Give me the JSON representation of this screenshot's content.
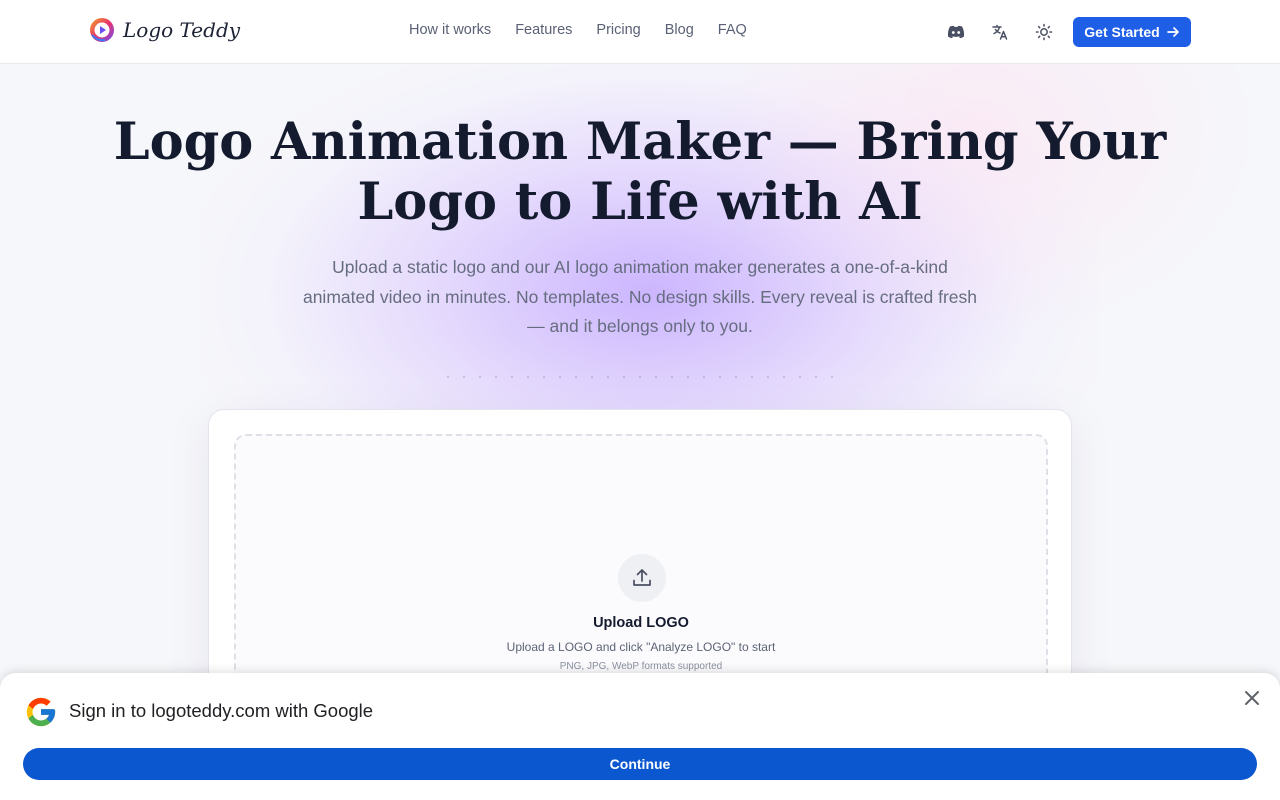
{
  "header": {
    "brand_name": "Logo Teddy",
    "nav": [
      "How it works",
      "Features",
      "Pricing",
      "Blog",
      "FAQ"
    ],
    "icons": [
      "discord-icon",
      "translate-icon",
      "sun-icon"
    ],
    "cta_label": "Get Started"
  },
  "hero": {
    "title": "Logo Animation Maker — Bring Your Logo to Life with AI",
    "subtitle": "Upload a static logo and our AI logo animation maker generates a one-of-a-kind animated video in minutes. No templates. No design skills. Every reveal is crafted fresh — and it belongs only to you."
  },
  "upload": {
    "title": "Upload LOGO",
    "hint": "Upload a LOGO and click \"Analyze LOGO\" to start",
    "formats": "PNG, JPG, WebP formats supported"
  },
  "google_signin": {
    "title": "Sign in to logoteddy.com with Google",
    "continue_label": "Continue"
  },
  "colors": {
    "primary": "#1f5fe8",
    "google_blue": "#0b57d0",
    "glow": "#c4aaff"
  }
}
